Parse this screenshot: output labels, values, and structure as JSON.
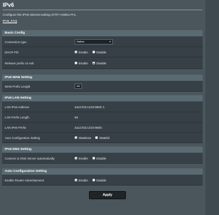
{
  "page": {
    "title": "IPv6",
    "description": "Configure the IPv6 Internet setting of RT-AX86U Pro.",
    "faq_link": "IPv6_FAQ",
    "apply_label": "Apply"
  },
  "basic_config": {
    "header": "Basic Config",
    "connection_type": {
      "label": "Connection type",
      "value": "Native"
    },
    "dhcp_pd": {
      "label": "DHCP-PD",
      "options": [
        "Enable",
        "Disable"
      ],
      "selected": "Enable"
    },
    "release_prefix": {
      "label": "Release prefix on exit",
      "options": [
        "Enable",
        "Disable"
      ],
      "selected": "Disable"
    }
  },
  "wan_setting": {
    "header": "IPv6 WAN Setting",
    "prefix_length": {
      "label": "WAN Prefix Length",
      "value": "64"
    }
  },
  "lan_setting": {
    "header": "IPv6 LAN Setting",
    "lan_address": {
      "label": "LAN IPv6 Address",
      "value": "2a12:f43:1210:9600::1"
    },
    "lan_prefix_length": {
      "label": "LAN Prefix Length",
      "value": "56"
    },
    "lan_prefix": {
      "label": "LAN IPv6 Prefix",
      "value": "2a12:f43:1210:9600::"
    },
    "auto_config": {
      "label": "Auto Configuration Setting",
      "options": [
        "Stateless",
        "Stateful"
      ],
      "selected": "Stateless"
    }
  },
  "dns_setting": {
    "header": "IPv6 DNS Setting",
    "connect_dns": {
      "label": "Connect to DNS Server automatically",
      "options": [
        "Enable",
        "Disable"
      ],
      "selected": "Enable"
    }
  },
  "auto_config_setting": {
    "header": "Auto Configuration Setting",
    "router_adv": {
      "label": "Enable Router Advertisement",
      "options": [
        "Enable",
        "Disable"
      ],
      "selected": "Enable"
    }
  },
  "icons": {
    "dropdown": "chevron-down-icon"
  }
}
